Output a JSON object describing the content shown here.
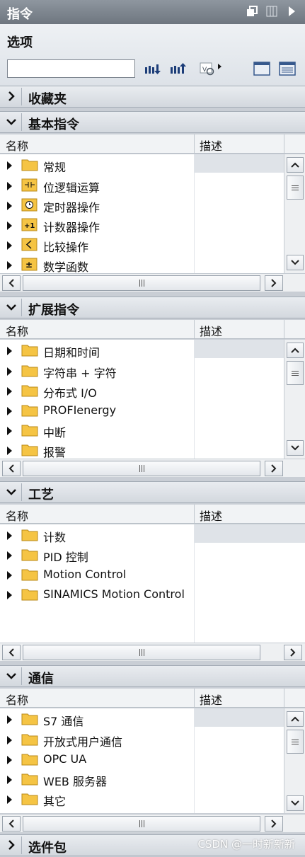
{
  "panel": {
    "title": "指令"
  },
  "options": {
    "label": "选项",
    "search": {
      "value": "",
      "placeholder": ""
    }
  },
  "columns": {
    "name": "名称",
    "description": "描述"
  },
  "sections": [
    {
      "title": "收藏夹",
      "state": "collapsed"
    },
    {
      "title": "基本指令",
      "state": "expanded",
      "items": [
        {
          "label": "常规",
          "icon": "folder-icon"
        },
        {
          "label": "位逻辑运算",
          "icon": "bit-logic-icon"
        },
        {
          "label": "定时器操作",
          "icon": "timer-icon"
        },
        {
          "label": "计数器操作",
          "icon": "counter-icon"
        },
        {
          "label": "比较操作",
          "icon": "compare-icon"
        },
        {
          "label": "数学函数",
          "icon": "math-icon"
        }
      ]
    },
    {
      "title": "扩展指令",
      "state": "expanded",
      "items": [
        {
          "label": "日期和时间",
          "icon": "folder-icon"
        },
        {
          "label": "字符串 + 字符",
          "icon": "folder-icon"
        },
        {
          "label": "分布式 I/O",
          "icon": "folder-icon"
        },
        {
          "label": "PROFIenergy",
          "icon": "folder-icon"
        },
        {
          "label": "中断",
          "icon": "folder-icon"
        },
        {
          "label": "报警",
          "icon": "folder-icon"
        }
      ]
    },
    {
      "title": "工艺",
      "state": "expanded",
      "items": [
        {
          "label": "计数",
          "icon": "folder-icon"
        },
        {
          "label": "PID 控制",
          "icon": "folder-icon"
        },
        {
          "label": "Motion Control",
          "icon": "folder-icon"
        },
        {
          "label": "SINAMICS Motion Control",
          "icon": "folder-icon"
        }
      ]
    },
    {
      "title": "通信",
      "state": "expanded",
      "items": [
        {
          "label": "S7 通信",
          "icon": "folder-icon"
        },
        {
          "label": "开放式用户通信",
          "icon": "folder-icon"
        },
        {
          "label": "OPC UA",
          "icon": "folder-icon"
        },
        {
          "label": "WEB 服务器",
          "icon": "folder-icon"
        },
        {
          "label": "其它",
          "icon": "folder-icon"
        }
      ]
    },
    {
      "title": "选件包",
      "state": "collapsed"
    }
  ],
  "watermark": "CSDN @一时新新新",
  "colors": {
    "folder": "#f5c444",
    "folder_edge": "#b98a18",
    "titlebar": "#7d858e",
    "section": "#dfe3e8"
  }
}
